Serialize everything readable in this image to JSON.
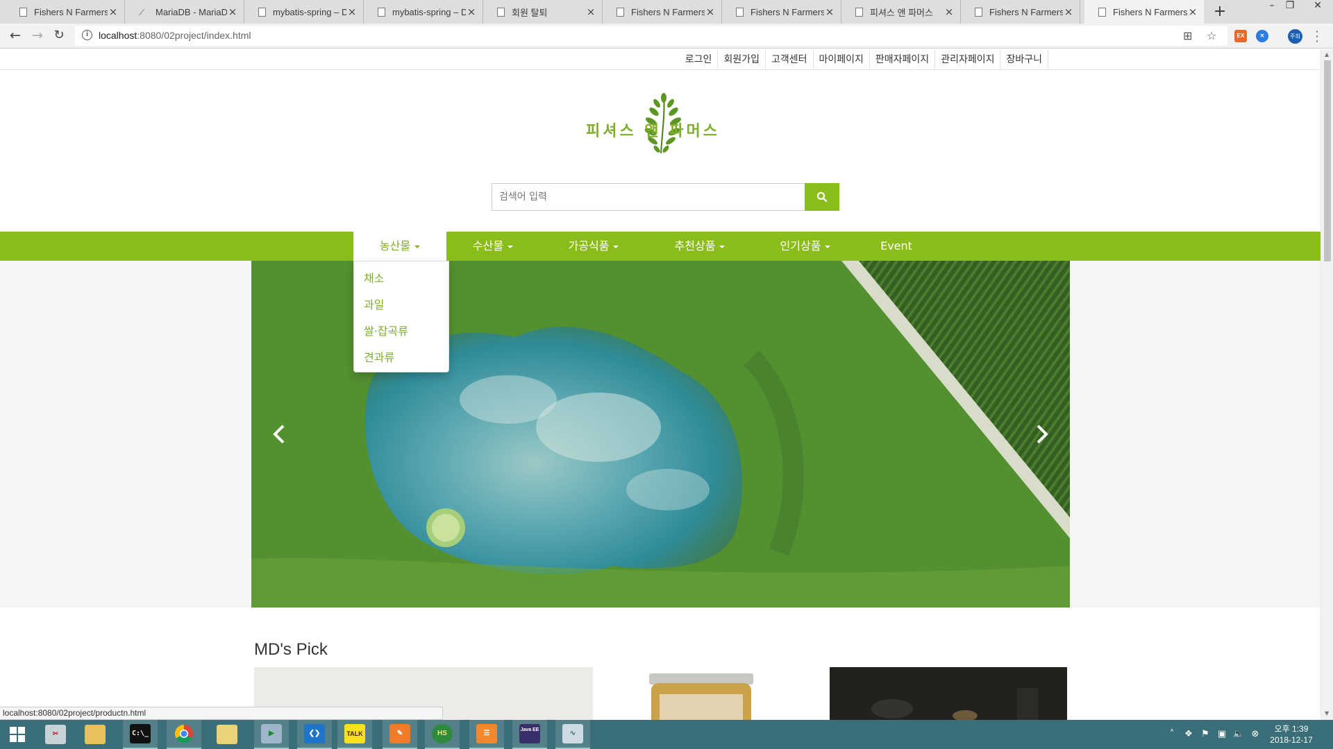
{
  "browser": {
    "tabs": [
      {
        "title": "Fishers N Farmers",
        "icon": "page-icon",
        "active": false
      },
      {
        "title": "MariaDB - MariaDB",
        "icon": "mariadb-icon",
        "active": false
      },
      {
        "title": "mybatis-spring – Di",
        "icon": "page-icon",
        "active": false
      },
      {
        "title": "mybatis-spring – Di",
        "icon": "page-icon",
        "active": false
      },
      {
        "title": "회원 탈퇴",
        "icon": "page-icon",
        "active": false
      },
      {
        "title": "Fishers N Farmers",
        "icon": "page-icon",
        "active": false
      },
      {
        "title": "Fishers N Farmers",
        "icon": "page-icon",
        "active": false
      },
      {
        "title": "피셔스 앤 파머스",
        "icon": "page-icon",
        "active": false
      },
      {
        "title": "Fishers N Farmers",
        "icon": "page-icon",
        "active": false
      },
      {
        "title": "Fishers N Farmers",
        "icon": "page-icon",
        "active": true
      }
    ],
    "url_host": "localhost",
    "url_rest": ":8080/02project/index.html",
    "profile_label": "주희",
    "extension_label": "EX"
  },
  "page": {
    "util_links": [
      "로그인",
      "회원가입",
      "고객센터",
      "마이페이지",
      "판매자페이지",
      "관리자페이지",
      "장바구니"
    ],
    "logo_text": "피셔스 앤 파머스",
    "search": {
      "placeholder": "검색어 입력",
      "icon": "search-icon"
    },
    "nav": [
      {
        "label": "농산물",
        "dropdown": true,
        "active": true
      },
      {
        "label": "수산물",
        "dropdown": true,
        "active": false
      },
      {
        "label": "가공식품",
        "dropdown": true,
        "active": false
      },
      {
        "label": "추천상품",
        "dropdown": true,
        "active": false
      },
      {
        "label": "인기상품",
        "dropdown": true,
        "active": false
      },
      {
        "label": "Event",
        "dropdown": false,
        "active": false
      }
    ],
    "dropdown_items": [
      "채소",
      "과일",
      "쌀·잡곡류",
      "견과류"
    ],
    "md_title": "MD's Pick",
    "status_url": "localhost:8080/02project/productn.html"
  },
  "taskbar": {
    "items": [
      "start-icon",
      "snipping-tool-icon",
      "file-explorer-icon",
      "command-prompt-icon",
      "chrome-icon",
      "folder-icon",
      "media-player-icon",
      "vscode-icon",
      "kakaotalk-icon",
      "pdf-icon",
      "hs-icon",
      "app-icon",
      "eclipse-icon",
      "resource-monitor-icon"
    ],
    "talk_label": "TALK",
    "hs_label": "HS",
    "java_label": "Java EE",
    "clock_time": "오후 1:39",
    "clock_date": "2018-12-17"
  },
  "colors": {
    "brand_green": "#8bbd1a",
    "taskbar": "#3a6e78",
    "tab_strip": "#dedede"
  }
}
